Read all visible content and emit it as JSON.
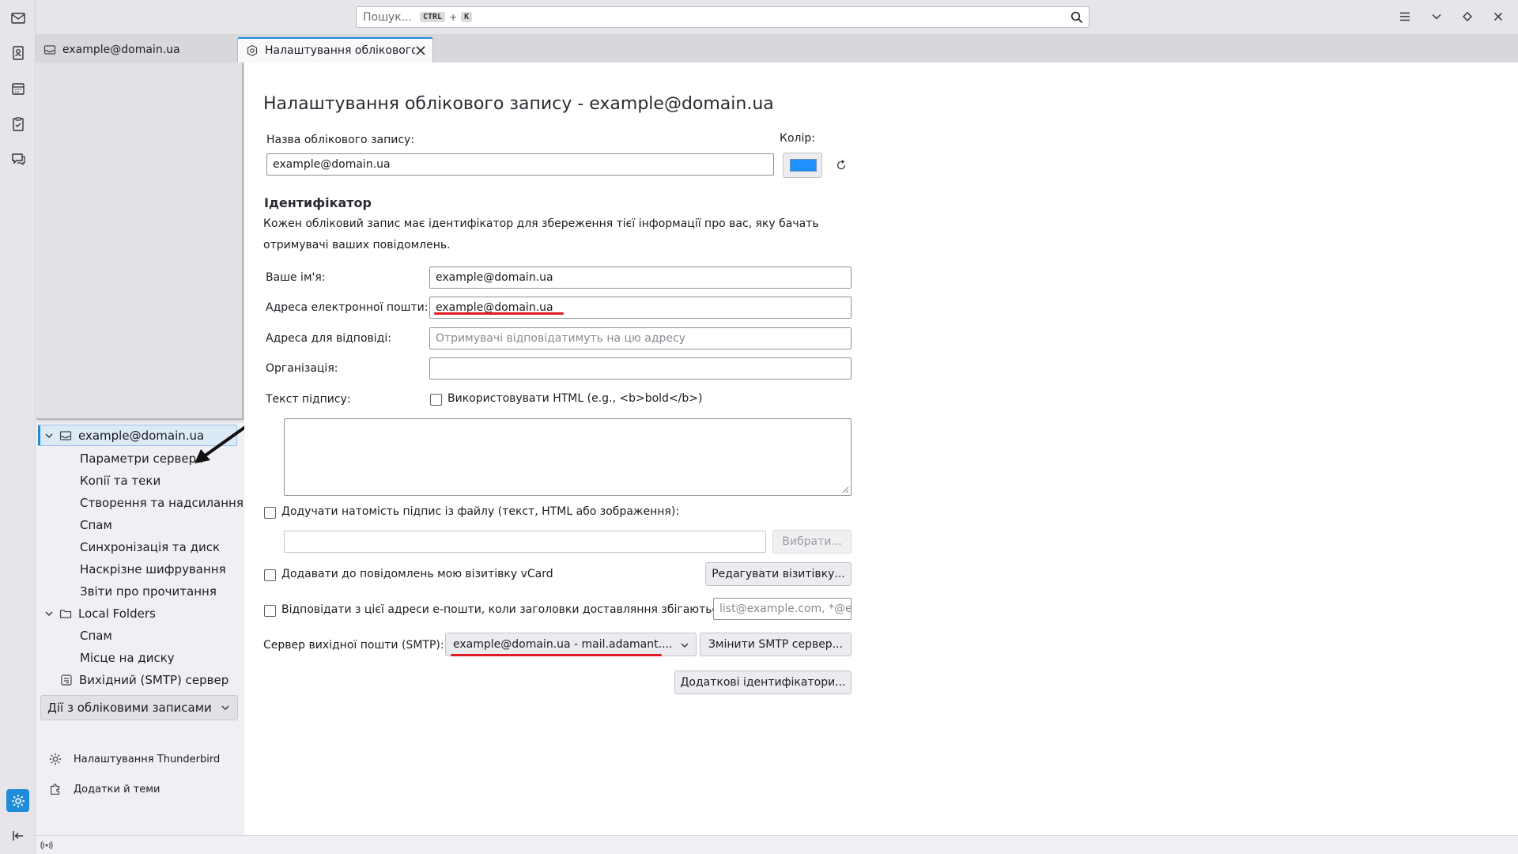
{
  "search": {
    "placeholder": "Пошук...",
    "key1": "CTRL",
    "plus": "+",
    "key2": "K"
  },
  "tabs": [
    {
      "label": "example@domain.ua"
    },
    {
      "label": "Налаштування облікового за"
    }
  ],
  "sidebar": {
    "account": "example@domain.ua",
    "account_items": [
      "Параметри сервера",
      "Копії та теки",
      "Створення та надсилання",
      "Спам",
      "Синхронізація та диск",
      "Наскрізне шифрування",
      "Звіти про прочитання"
    ],
    "local_folders": "Local Folders",
    "local_items": [
      "Спам",
      "Місце на диску"
    ],
    "smtp": "Вихідний (SMTP) сервер",
    "account_actions": "Дії з обліковими записами",
    "footer": {
      "settings": "Налаштування Thunderbird",
      "addons": "Додатки й теми"
    }
  },
  "main": {
    "title": "Налаштування облікового запису - example@domain.ua",
    "account_name_label": "Назва облікового запису:",
    "account_name_value": "example@domain.ua",
    "color_label": "Колір:",
    "color_value": "#1e90ff",
    "identity_title": "Ідентифікатор",
    "identity_desc_line1": "Кожен обліковий запис має ідентифікатор для збереження тієї інформації про вас, яку бачать",
    "identity_desc_line2": "отримувачі ваших повідомлень.",
    "your_name_label": "Ваше ім'я:",
    "your_name_value": "example@domain.ua",
    "email_label": "Адреса електронної пошти:",
    "email_value": "example@domain.ua",
    "reply_label": "Адреса для відповіді:",
    "reply_placeholder": "Отримувачі відповідатимуть на цю адресу",
    "org_label": "Організація:",
    "org_value": "",
    "signature_label": "Текст підпису:",
    "use_html_label": "Використовувати HTML (e.g., <b>bold</b>)",
    "attach_sig_label": "Додучати натомість підпис із файлу (текст, HTML або зображення):",
    "choose_button": "Вибрати...",
    "vcard_label": "Додавати до повідомлень мою візитівку vCard",
    "edit_vcard_button": "Редагувати візитівку...",
    "reply_from_label": "Відповідати з цієї адреси е-пошти, коли заголовки доставляння збігаються:",
    "reply_from_placeholder": "list@example.com, *@e",
    "smtp_label": "Сервер вихідної пошти (SMTP):",
    "smtp_value": "example@domain.ua - mail.adamant....",
    "change_smtp_button": "Змінити SMTP сервер...",
    "more_identities_button": "Додаткові ідентифікатори..."
  },
  "colors": {
    "accent": "#1e8cd9",
    "annotation": "#e01b24"
  }
}
